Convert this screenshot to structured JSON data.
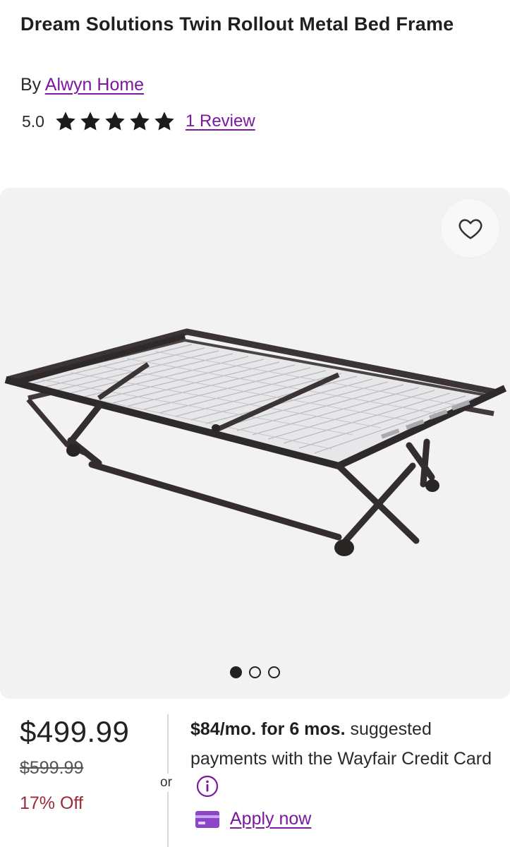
{
  "product": {
    "title": "Dream Solutions Twin Rollout Metal Bed Frame",
    "by_label": "By",
    "brand": "Alwyn Home",
    "rating": "5.0",
    "stars": 5,
    "reviews_label": "1 Review"
  },
  "gallery": {
    "image_count": 3,
    "active_index": 0
  },
  "pricing": {
    "price": "$499.99",
    "was_price": "$599.99",
    "discount": "17% Off",
    "or_label": "or",
    "financing_bold": "$84/mo. for 6 mos.",
    "financing_text": "suggested payments with the Wayfair Credit Card",
    "apply_label": "Apply now"
  },
  "icons": {
    "favorite": "heart-icon",
    "info": "info-icon",
    "card": "credit-card-icon",
    "star": "star-icon"
  },
  "colors": {
    "link": "#7b189f",
    "discount": "#9d2a3a",
    "star": "#1b1b1b",
    "gallery_bg": "#f3f2f2"
  }
}
